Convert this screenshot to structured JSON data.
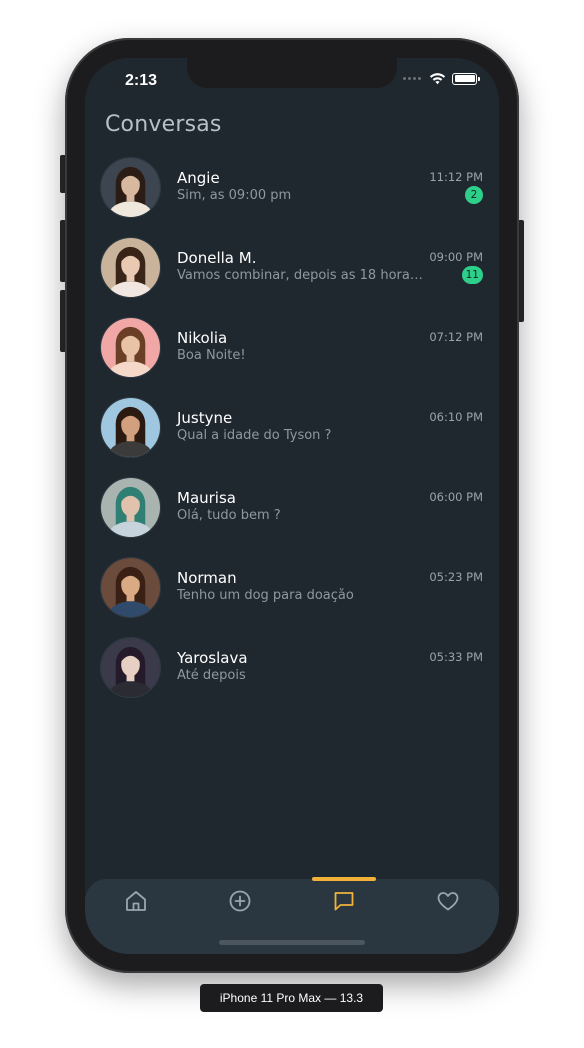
{
  "status_bar": {
    "time": "2:13"
  },
  "header": {
    "title": "Conversas"
  },
  "conversations": [
    {
      "name": "Angie",
      "message": "Sim, as 09:00 pm",
      "time": "11:12 PM",
      "unread": "2",
      "avatar_bg": "#3c4550",
      "skin": "#d9b8a0",
      "hair": "#2b1d16",
      "shirt": "#f0e8dc"
    },
    {
      "name": "Donella M.",
      "message": "Vamos combinar, depois as 18 horas...",
      "time": "09:00 PM",
      "unread": "11",
      "avatar_bg": "#c9b39a",
      "skin": "#e9c9b2",
      "hair": "#3a2418",
      "shirt": "#f2e6e0"
    },
    {
      "name": "Nikolia",
      "message": "Boa Noite!",
      "time": "07:12 PM",
      "unread": "",
      "avatar_bg": "#f0a7a6",
      "skin": "#e8c3a6",
      "hair": "#6b3f25",
      "shirt": "#f6d8c8"
    },
    {
      "name": "Justyne",
      "message": "Qual a idade do Tyson ?",
      "time": "06:10 PM",
      "unread": "",
      "avatar_bg": "#9fc7df",
      "skin": "#d2a07e",
      "hair": "#2a1a12",
      "shirt": "#3b3b3b"
    },
    {
      "name": "Maurisa",
      "message": "Olá, tudo bem ?",
      "time": "06:00 PM",
      "unread": "",
      "avatar_bg": "#a9b4b0",
      "skin": "#e1c2ad",
      "hair": "#2f7f74",
      "shirt": "#c7d3dc"
    },
    {
      "name": "Norman",
      "message": "Tenho um dog para doaçåo",
      "time": "05:23 PM",
      "unread": "",
      "avatar_bg": "#6b4b3c",
      "skin": "#d9aa84",
      "hair": "#3a2014",
      "shirt": "#2f4a6b"
    },
    {
      "name": "Yaroslava",
      "message": "Até depois",
      "time": "05:33 PM",
      "unread": "",
      "avatar_bg": "#3a3a4a",
      "skin": "#e8cfc3",
      "hair": "#241a2a",
      "shirt": "#2b2b33"
    }
  ],
  "tabbar": {
    "tabs": [
      {
        "icon": "home-icon",
        "active": false
      },
      {
        "icon": "plus-circle-icon",
        "active": false
      },
      {
        "icon": "message-icon",
        "active": true
      },
      {
        "icon": "heart-icon",
        "active": false
      }
    ],
    "active_color": "#f2b23a",
    "inactive_color": "#9aa5ad"
  },
  "device_label": "iPhone 11 Pro Max — 13.3",
  "colors": {
    "screen_bg": "#20282f",
    "tabbar_bg": "#2a3740",
    "badge_bg": "#2ecf8a",
    "accent": "#f2b23a"
  }
}
